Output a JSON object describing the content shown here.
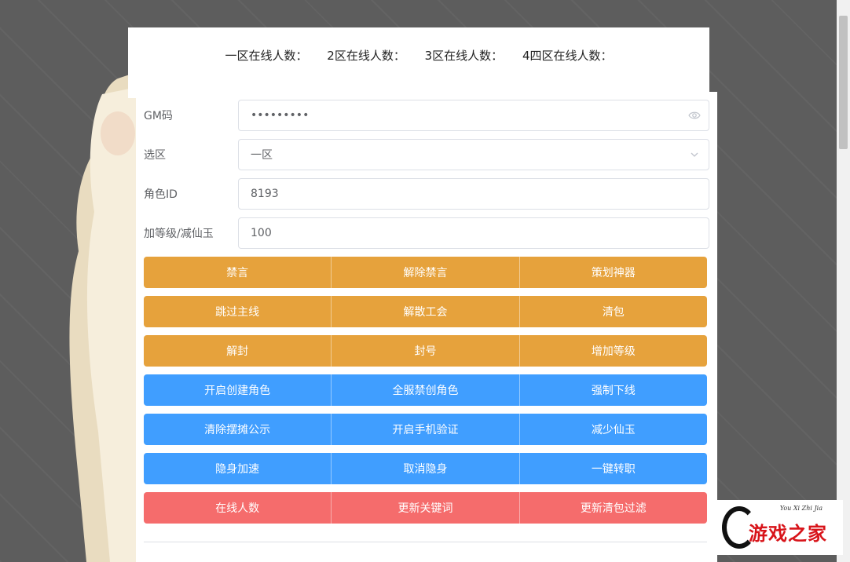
{
  "online": {
    "zone1": "一区在线人数：",
    "zone2": "2区在线人数：",
    "zone3": "3区在线人数：",
    "zone4": "4四区在线人数："
  },
  "form": {
    "gm_label": "GM码",
    "gm_value": "•••••••••",
    "zone_label": "选区",
    "zone_value": "一区",
    "role_label": "角色ID",
    "role_value": "8193",
    "level_label": "加等级/减仙玉",
    "level_value": "100"
  },
  "buttons": {
    "row1": [
      "禁言",
      "解除禁言",
      "策划神器"
    ],
    "row2": [
      "跳过主线",
      "解散工会",
      "清包"
    ],
    "row3": [
      "解封",
      "封号",
      "增加等级"
    ],
    "row4": [
      "开启创建角色",
      "全服禁创角色",
      "强制下线"
    ],
    "row5": [
      "清除摆摊公示",
      "开启手机验证",
      "减少仙玉"
    ],
    "row6": [
      "隐身加速",
      "取消隐身",
      "一键转职"
    ],
    "row7": [
      "在线人数",
      "更新关键词",
      "更新清包过滤"
    ]
  },
  "colors": {
    "orange": "#e6a23c",
    "blue": "#409eff",
    "red": "#f56c6c"
  },
  "icons": {
    "password_toggle": "eye-icon",
    "select_arrow": "chevron-down-icon"
  },
  "logo": {
    "text": "游戏之家",
    "sub": "You Xi Zhi Jia"
  }
}
